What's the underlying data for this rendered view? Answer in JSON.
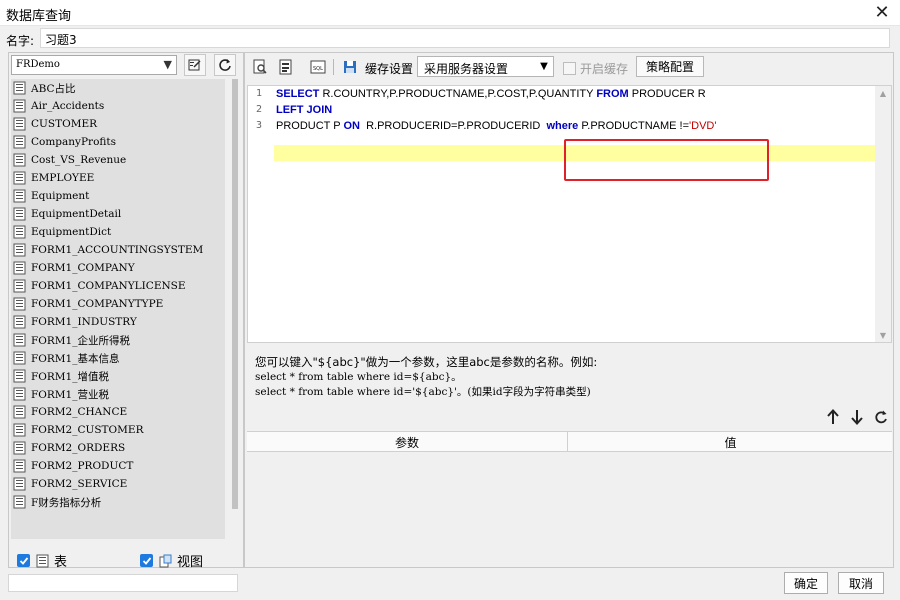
{
  "window": {
    "title": "数据库查询",
    "close_label": "✕"
  },
  "name_field": {
    "label": "名字:",
    "value": "习题3"
  },
  "left_panel": {
    "datasource": "FRDemo",
    "tables": [
      "ABC占比",
      "Air_Accidents",
      "CUSTOMER",
      "CompanyProfits",
      "Cost_VS_Revenue",
      "EMPLOYEE",
      "Equipment",
      "EquipmentDetail",
      "EquipmentDict",
      "FORM1_ACCOUNTINGSYSTEM",
      "FORM1_COMPANY",
      "FORM1_COMPANYLICENSE",
      "FORM1_COMPANYTYPE",
      "FORM1_INDUSTRY",
      "FORM1_企业所得税",
      "FORM1_基本信息",
      "FORM1_增值税",
      "FORM1_营业税",
      "FORM2_CHANCE",
      "FORM2_CUSTOMER",
      "FORM2_ORDERS",
      "FORM2_PRODUCT",
      "FORM2_SERVICE",
      "F财务指标分析"
    ],
    "checkbox_table_label": "表",
    "checkbox_view_label": "视图"
  },
  "toolbar": {
    "cache_label": "缓存设置",
    "cache_select_value": "采用服务器设置",
    "enable_cache_label": "开启缓存",
    "strategy_button": "策略配置"
  },
  "editor": {
    "line_numbers": [
      "1",
      "2",
      "3"
    ],
    "line1": {
      "kw1": "SELECT",
      "t1": " R.COUNTRY,P.PRODUCTNAME,P.COST,P.QUANTITY ",
      "kw2": "FROM",
      "t2": " PRODUCER R"
    },
    "line2": {
      "kw1": "LEFT JOIN"
    },
    "line3": {
      "t1": "PRODUCT P ",
      "kw1": "ON",
      "t2": "  R.PRODUCERID=P.PRODUCERID  ",
      "kw2": "where",
      "t3": " P.PRODUCTNAME !=",
      "str": "'DVD'"
    }
  },
  "hint": {
    "line1": "您可以键入\"${abc}\"做为一个参数，这里abc是参数的名称。例如:",
    "line2": "select * from table where id=${abc}。",
    "line3": "select * from table where id='${abc}'。(如果id字段为字符串类型)"
  },
  "param_table": {
    "col_param": "参数",
    "col_value": "值"
  },
  "buttons": {
    "ok": "确定",
    "cancel": "取消"
  },
  "colors": {
    "keyword": "#0000c0",
    "string": "#c00000",
    "highlight": "#ffffa0",
    "annotation_box": "#e0202a",
    "checkbox": "#1f7ae0"
  }
}
